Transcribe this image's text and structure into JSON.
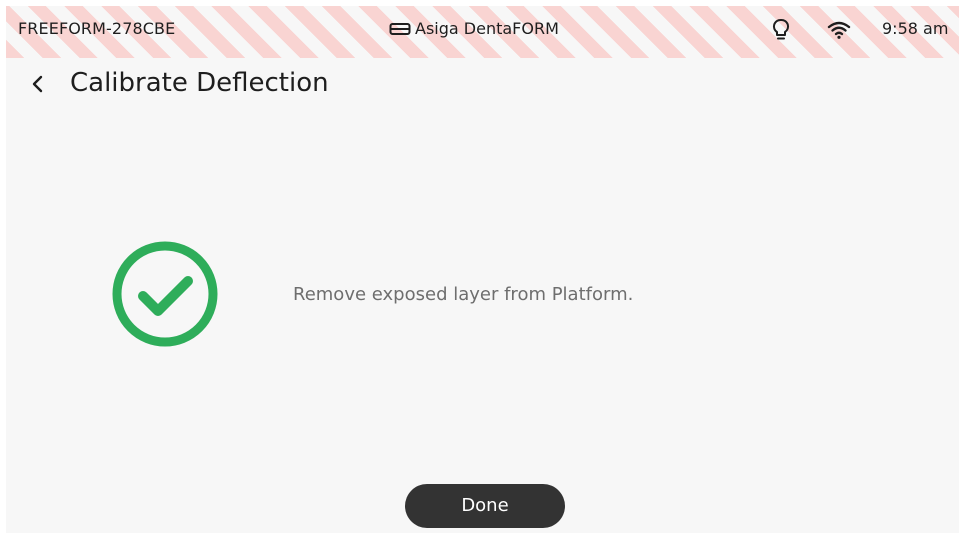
{
  "status_bar": {
    "device_name": "FREEFORM-278CBE",
    "printer_model": "Asiga DentaFORM",
    "printer_icon": "printer-icon",
    "bulb_icon": "lightbulb-icon",
    "wifi_icon": "wifi-icon",
    "time": "9:58 am"
  },
  "header": {
    "back_icon": "chevron-left-icon",
    "title": "Calibrate Deflection"
  },
  "main": {
    "status_icon": "check-circle-icon",
    "message": "Remove exposed layer from Platform."
  },
  "footer": {
    "done_label": "Done"
  },
  "colors": {
    "success": "#2ead5a",
    "button_bg": "#333333",
    "warning_stripe": "#f9d4d2",
    "background": "#f7f7f7"
  }
}
